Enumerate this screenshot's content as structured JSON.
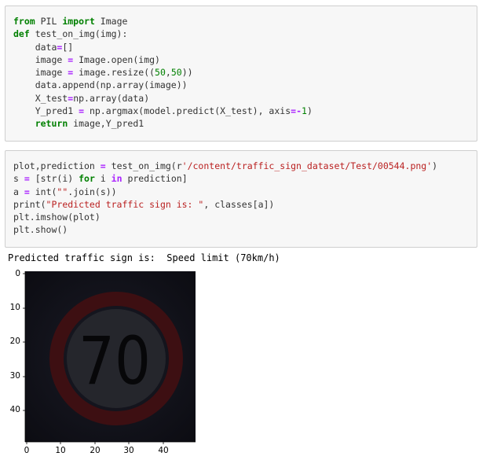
{
  "cell1": {
    "lines": [
      [
        {
          "t": "from",
          "c": "kw"
        },
        {
          "t": " PIL "
        },
        {
          "t": "import",
          "c": "kw"
        },
        {
          "t": " Image"
        }
      ],
      [
        {
          "t": "def",
          "c": "kw"
        },
        {
          "t": " test_on_img(img):"
        }
      ],
      [
        {
          "t": "    data"
        },
        {
          "t": "=",
          "c": "op"
        },
        {
          "t": "[]"
        }
      ],
      [
        {
          "t": "    image "
        },
        {
          "t": "=",
          "c": "op"
        },
        {
          "t": " Image.open(img)"
        }
      ],
      [
        {
          "t": "    image "
        },
        {
          "t": "=",
          "c": "op"
        },
        {
          "t": " image.resize(("
        },
        {
          "t": "50",
          "c": "num"
        },
        {
          "t": ","
        },
        {
          "t": "50",
          "c": "num"
        },
        {
          "t": "))"
        }
      ],
      [
        {
          "t": "    data.append(np.array(image))"
        }
      ],
      [
        {
          "t": "    X_test"
        },
        {
          "t": "=",
          "c": "op"
        },
        {
          "t": "np.array(data)"
        }
      ],
      [
        {
          "t": "    Y_pred1 "
        },
        {
          "t": "=",
          "c": "op"
        },
        {
          "t": " np.argmax(model.predict(X_test), axis"
        },
        {
          "t": "=-",
          "c": "op"
        },
        {
          "t": "1",
          "c": "num"
        },
        {
          "t": ")"
        }
      ],
      [
        {
          "t": "    "
        },
        {
          "t": "return",
          "c": "kw"
        },
        {
          "t": " image,Y_pred1"
        }
      ]
    ]
  },
  "cell2": {
    "lines": [
      [
        {
          "t": "plot,prediction "
        },
        {
          "t": "=",
          "c": "op"
        },
        {
          "t": " test_on_img(r"
        },
        {
          "t": "'/content/traffic_sign_dataset/Test/00544.png'",
          "c": "str"
        },
        {
          "t": ")"
        }
      ],
      [
        {
          "t": "s "
        },
        {
          "t": "=",
          "c": "op"
        },
        {
          "t": " [str(i) "
        },
        {
          "t": "for",
          "c": "kw"
        },
        {
          "t": " i "
        },
        {
          "t": "in",
          "c": "op"
        },
        {
          "t": " prediction]"
        }
      ],
      [
        {
          "t": "a "
        },
        {
          "t": "=",
          "c": "op"
        },
        {
          "t": " int("
        },
        {
          "t": "\"\"",
          "c": "str"
        },
        {
          "t": ".join(s))"
        }
      ],
      [
        {
          "t": "print("
        },
        {
          "t": "\"Predicted traffic sign is: \"",
          "c": "str"
        },
        {
          "t": ", classes[a])"
        }
      ],
      [
        {
          "t": "plt.imshow(plot)"
        }
      ],
      [
        {
          "t": "plt.show()"
        }
      ]
    ]
  },
  "output": {
    "text": "Predicted traffic sign is:  Speed limit (70km/h)"
  },
  "plot": {
    "yticks": [
      "0",
      "10",
      "20",
      "30",
      "40"
    ],
    "xticks": [
      "0",
      "10",
      "20",
      "30",
      "40"
    ],
    "image_label": "70"
  }
}
